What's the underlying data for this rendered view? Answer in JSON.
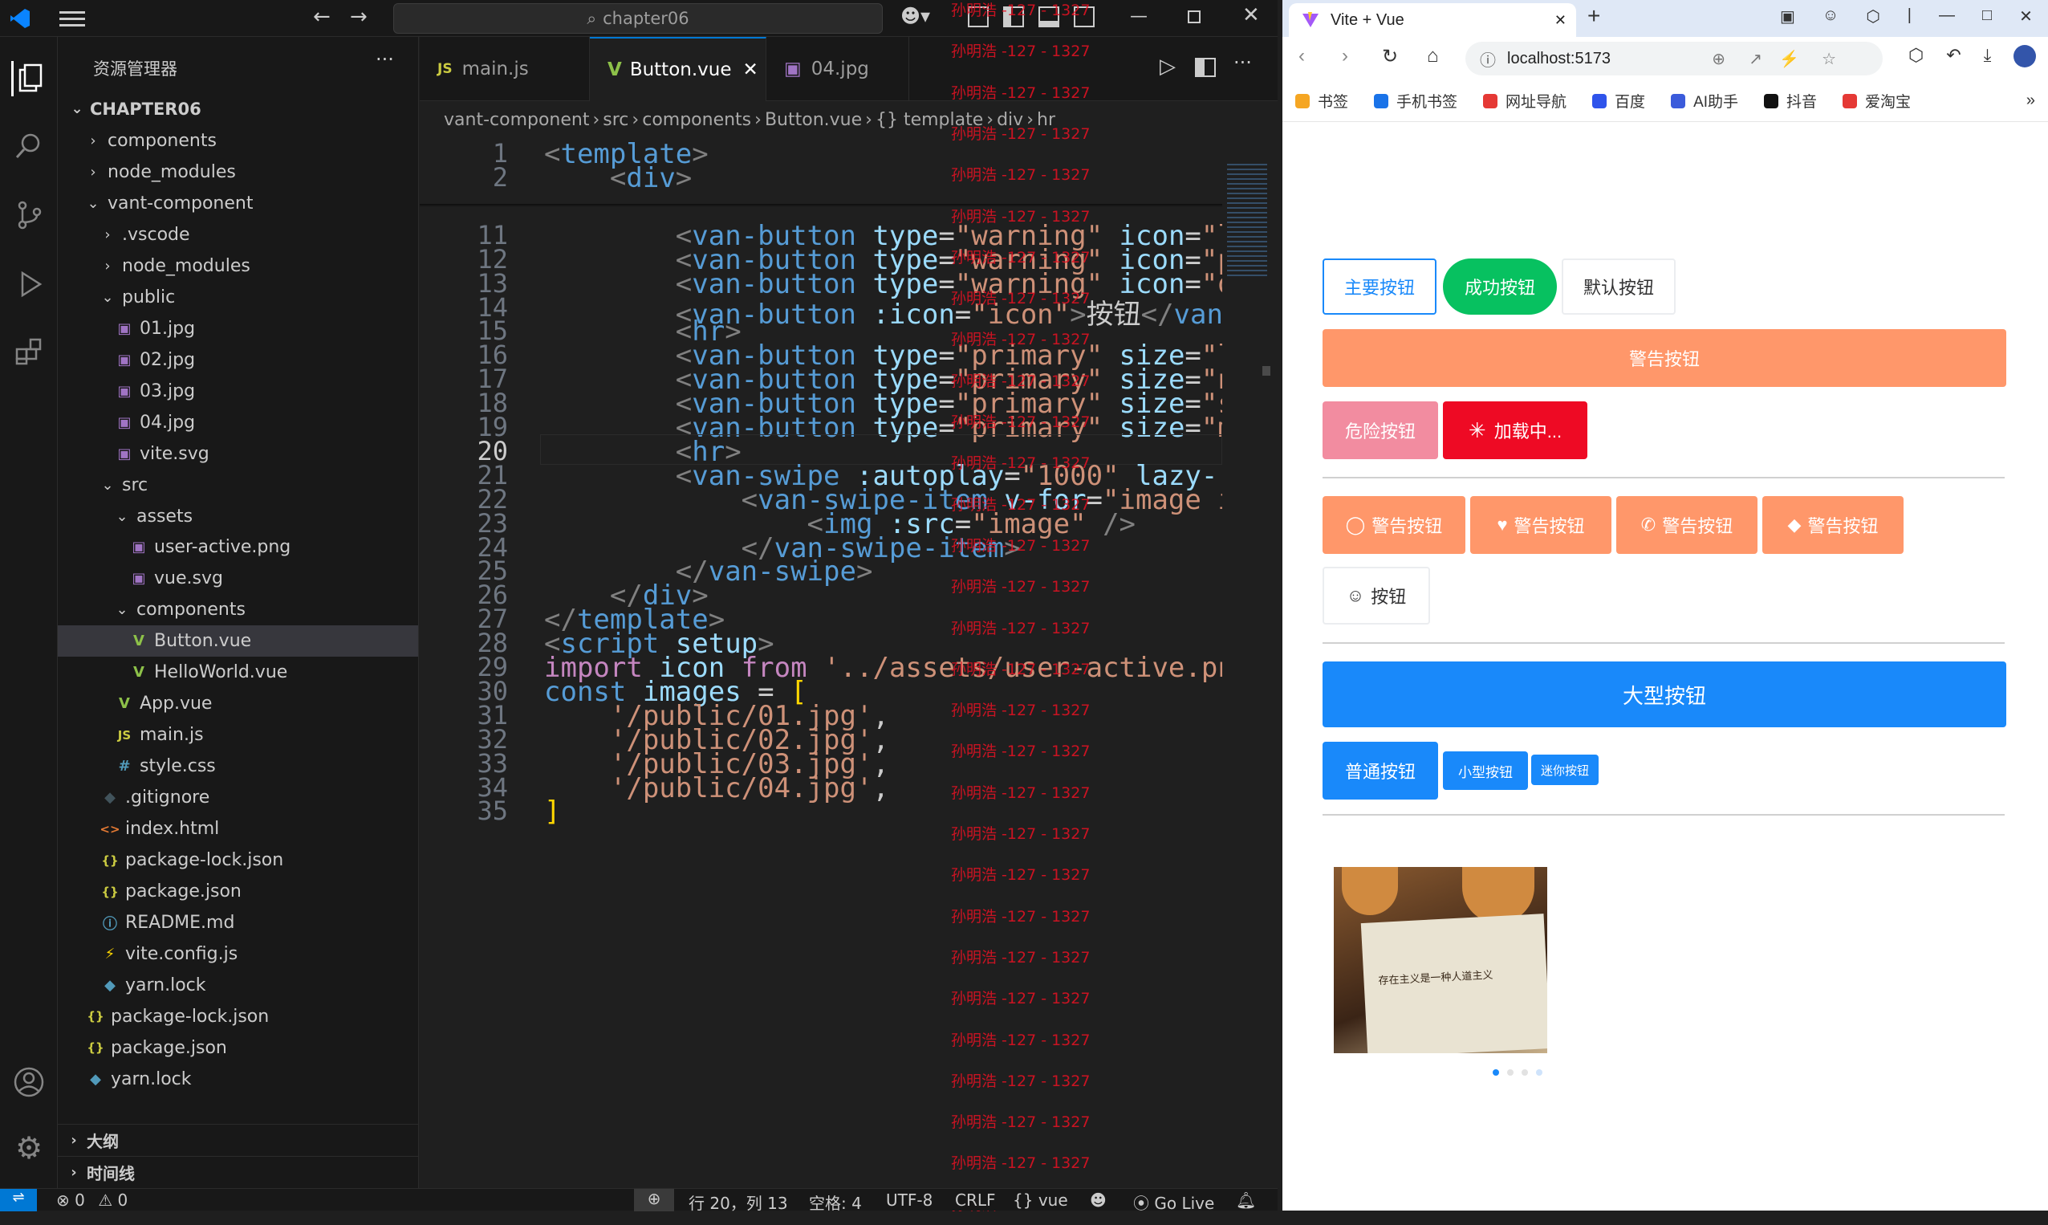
{
  "vscode": {
    "search_box": "chapter06",
    "explorer_title": "资源管理器",
    "project_name": "CHAPTER06",
    "tree": [
      {
        "label": "components",
        "depth": 0,
        "kind": "folder",
        "open": false
      },
      {
        "label": "node_modules",
        "depth": 0,
        "kind": "folder",
        "open": false
      },
      {
        "label": "vant-component",
        "depth": 0,
        "kind": "folder",
        "open": true
      },
      {
        "label": ".vscode",
        "depth": 1,
        "kind": "folder",
        "open": false
      },
      {
        "label": "node_modules",
        "depth": 1,
        "kind": "folder",
        "open": false
      },
      {
        "label": "public",
        "depth": 1,
        "kind": "folder",
        "open": true
      },
      {
        "label": "01.jpg",
        "depth": 2,
        "kind": "img"
      },
      {
        "label": "02.jpg",
        "depth": 2,
        "kind": "img"
      },
      {
        "label": "03.jpg",
        "depth": 2,
        "kind": "img"
      },
      {
        "label": "04.jpg",
        "depth": 2,
        "kind": "img"
      },
      {
        "label": "vite.svg",
        "depth": 2,
        "kind": "img"
      },
      {
        "label": "src",
        "depth": 1,
        "kind": "folder",
        "open": true
      },
      {
        "label": "assets",
        "depth": 2,
        "kind": "folder",
        "open": true
      },
      {
        "label": "user-active.png",
        "depth": 3,
        "kind": "img"
      },
      {
        "label": "vue.svg",
        "depth": 3,
        "kind": "img"
      },
      {
        "label": "components",
        "depth": 2,
        "kind": "folder",
        "open": true
      },
      {
        "label": "Button.vue",
        "depth": 3,
        "kind": "vue",
        "selected": true
      },
      {
        "label": "HelloWorld.vue",
        "depth": 3,
        "kind": "vue"
      },
      {
        "label": "App.vue",
        "depth": 2,
        "kind": "vue"
      },
      {
        "label": "main.js",
        "depth": 2,
        "kind": "js"
      },
      {
        "label": "style.css",
        "depth": 2,
        "kind": "css"
      },
      {
        "label": ".gitignore",
        "depth": 1,
        "kind": "git"
      },
      {
        "label": "index.html",
        "depth": 1,
        "kind": "html"
      },
      {
        "label": "package-lock.json",
        "depth": 1,
        "kind": "json"
      },
      {
        "label": "package.json",
        "depth": 1,
        "kind": "json"
      },
      {
        "label": "README.md",
        "depth": 1,
        "kind": "info"
      },
      {
        "label": "vite.config.js",
        "depth": 1,
        "kind": "vite"
      },
      {
        "label": "yarn.lock",
        "depth": 1,
        "kind": "yarn"
      },
      {
        "label": "package-lock.json",
        "depth": 0,
        "kind": "json"
      },
      {
        "label": "package.json",
        "depth": 0,
        "kind": "json"
      },
      {
        "label": "yarn.lock",
        "depth": 0,
        "kind": "yarn"
      }
    ],
    "outline_label": "大纲",
    "timeline_label": "时间线",
    "tabs": [
      {
        "label": "main.js",
        "icon": "JS",
        "active": false
      },
      {
        "label": "Button.vue",
        "icon": "V",
        "active": true
      },
      {
        "label": "04.jpg",
        "icon": "img",
        "active": false
      }
    ],
    "breadcrumb": [
      "vant-component",
      "src",
      "components",
      "Button.vue",
      "{} template",
      "div",
      "hr"
    ],
    "code_lines": [
      {
        "n": "1",
        "html": "<span class='t-tag'>&lt;</span><span class='t-name'>template</span><span class='t-tag'>&gt;</span>"
      },
      {
        "n": "2",
        "html": "    <span class='t-tag'>&lt;</span><span class='t-name'>div</span><span class='t-tag'>&gt;</span>"
      },
      {
        "n": "11",
        "html": "        <span class='t-tag'>&lt;</span><span class='t-name'>van-button</span> <span class='t-attr'>type</span>=<span class='t-str'>\"warning\"</span> <span class='t-attr'>icon</span>=<span class='t-str'>\"l</span>"
      },
      {
        "n": "12",
        "html": "        <span class='t-tag'>&lt;</span><span class='t-name'>van-button</span> <span class='t-attr'>type</span>=<span class='t-str'>\"warning\"</span> <span class='t-attr'>icon</span>=<span class='t-str'>\"p</span>"
      },
      {
        "n": "13",
        "html": "        <span class='t-tag'>&lt;</span><span class='t-name'>van-button</span> <span class='t-attr'>type</span>=<span class='t-str'>\"warning\"</span> <span class='t-attr'>icon</span>=<span class='t-str'>\"d</span>"
      },
      {
        "n": "14",
        "html": "        <span class='t-tag'>&lt;</span><span class='t-name'>van-button</span> <span class='t-attr'>:icon</span>=<span class='t-str'>\"icon\"</span><span class='t-tag'>&gt;</span>按钮<span class='t-tag'>&lt;/</span><span class='t-name'>van-</span>"
      },
      {
        "n": "15",
        "html": "        <span class='t-tag'>&lt;</span><span class='t-name'>hr</span><span class='t-tag'>&gt;</span>"
      },
      {
        "n": "16",
        "html": "        <span class='t-tag'>&lt;</span><span class='t-name'>van-button</span> <span class='t-attr'>type</span>=<span class='t-str'>\"primary\"</span> <span class='t-attr'>size</span>=<span class='t-str'>\"l</span>"
      },
      {
        "n": "17",
        "html": "        <span class='t-tag'>&lt;</span><span class='t-name'>van-button</span> <span class='t-attr'>type</span>=<span class='t-str'>\"primary\"</span> <span class='t-attr'>size</span>=<span class='t-str'>\"n</span>"
      },
      {
        "n": "18",
        "html": "        <span class='t-tag'>&lt;</span><span class='t-name'>van-button</span> <span class='t-attr'>type</span>=<span class='t-str'>\"primary\"</span> <span class='t-attr'>size</span>=<span class='t-str'>\"s</span>"
      },
      {
        "n": "19",
        "html": "        <span class='t-tag'>&lt;</span><span class='t-name'>van-button</span> <span class='t-attr'>type</span>=<span class='t-str'>\"primary\"</span> <span class='t-attr'>size</span>=<span class='t-str'>\"m</span>"
      },
      {
        "n": "20",
        "html": "        <span class='t-tag'>&lt;</span><span class='t-name'>hr</span><span class='t-tag'>&gt;</span>",
        "current": true
      },
      {
        "n": "21",
        "html": "        <span class='t-tag'>&lt;</span><span class='t-name'>van-swipe</span> <span class='t-attr'>:autoplay</span>=<span class='t-str'>\"1000\"</span> <span class='t-attr'>lazy-r</span>"
      },
      {
        "n": "22",
        "html": "            <span class='t-tag'>&lt;</span><span class='t-name'>van-swipe-item</span> <span class='t-attr'>v-for</span>=<span class='t-str'>\"image i</span>"
      },
      {
        "n": "23",
        "html": "                <span class='t-tag'>&lt;</span><span class='t-name'>img</span> <span class='t-attr'>:src</span>=<span class='t-str'>\"image\"</span> <span class='t-tag'>/&gt;</span>"
      },
      {
        "n": "24",
        "html": "            <span class='t-tag'>&lt;/</span><span class='t-name'>van-swipe-item</span><span class='t-tag'>&gt;</span>"
      },
      {
        "n": "25",
        "html": "        <span class='t-tag'>&lt;/</span><span class='t-name'>van-swipe</span><span class='t-tag'>&gt;</span>"
      },
      {
        "n": "26",
        "html": "    <span class='t-tag'>&lt;/</span><span class='t-name'>div</span><span class='t-tag'>&gt;</span>"
      },
      {
        "n": "27",
        "html": "<span class='t-tag'>&lt;/</span><span class='t-name'>template</span><span class='t-tag'>&gt;</span>"
      },
      {
        "n": "28",
        "html": "<span class='t-tag'>&lt;</span><span class='t-name'>script</span> <span class='t-attr'>setup</span><span class='t-tag'>&gt;</span>"
      },
      {
        "n": "29",
        "html": "<span class='t-kw'>import</span> <span class='t-attr'>icon</span> <span class='t-kw'>from</span> <span class='t-str'>'../assets/user-active.pn</span>"
      },
      {
        "n": "30",
        "html": "<span class='t-blue'>const</span> <span class='t-attr'>images</span> = <span class='t-yel'>[</span>"
      },
      {
        "n": "31",
        "html": "    <span class='t-str'>'/public/01.jpg'</span>,"
      },
      {
        "n": "32",
        "html": "    <span class='t-str'>'/public/02.jpg'</span>,"
      },
      {
        "n": "33",
        "html": "    <span class='t-str'>'/public/03.jpg'</span>,"
      },
      {
        "n": "34",
        "html": "    <span class='t-str'>'/public/04.jpg'</span>,"
      },
      {
        "n": "35",
        "html": "<span class='t-yel'>]</span>"
      }
    ],
    "watermark": "孙明浩 -127 - 1327",
    "status": {
      "errors": "0",
      "warnings": "0",
      "position": "行 20，列 13",
      "spaces": "空格: 4",
      "encoding": "UTF-8",
      "eol": "CRLF",
      "lang": "vue",
      "live": "Go Live"
    }
  },
  "browser": {
    "tab_title": "Vite + Vue",
    "url": "localhost:5173",
    "bookmarks": [
      "书签",
      "手机书签",
      "网址导航",
      "百度",
      "AI助手",
      "抖音",
      "爱淘宝"
    ],
    "buttons_row1": [
      "主要按钮",
      "成功按钮",
      "默认按钮"
    ],
    "warning_block": "警告按钮",
    "danger": "危险按钮",
    "loading": "加载中...",
    "icon_buttons": [
      "警告按钮",
      "警告按钮",
      "警告按钮",
      "警告按钮"
    ],
    "user_icon_btn": "按钮",
    "large": "大型按钮",
    "normal": "普通按钮",
    "small": "小型按钮",
    "mini": "迷你按钮",
    "book_text": "存在主义是一种人道主义",
    "colors": {
      "primary": "#1989fa",
      "success": "#07c160",
      "warning": "#ff976a",
      "danger": "#ee0a24",
      "vscode_accent": "#0078d4"
    }
  }
}
